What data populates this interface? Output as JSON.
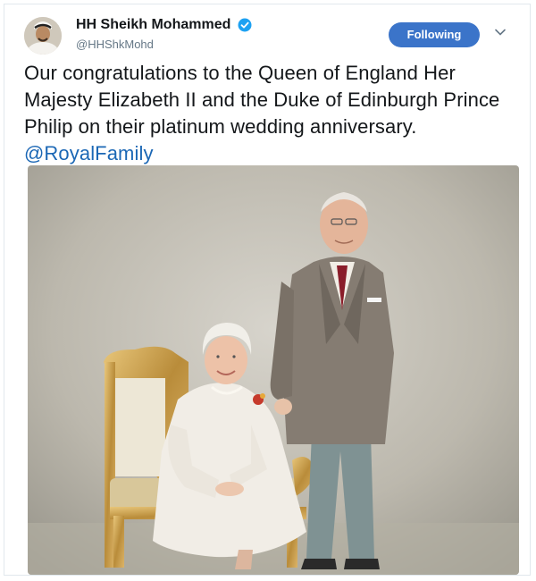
{
  "tweet": {
    "author": {
      "display_name": "HH Sheikh Mohammed",
      "handle": "@HHShkMohd",
      "verified_icon": "verified-badge-icon",
      "avatar_icon": "avatar-photo"
    },
    "follow_button": {
      "label": "Following",
      "color": "#3b74c9"
    },
    "menu_icon": "chevron-down-icon",
    "text": "Our congratulations to the Queen of England Her Majesty Elizabeth II and the Duke of Edinburgh Prince Philip on their platinum wedding anniversary. ",
    "mention": "@RoyalFamily",
    "mention_color": "#1b67b5",
    "photo_icon": "portrait-photo"
  }
}
